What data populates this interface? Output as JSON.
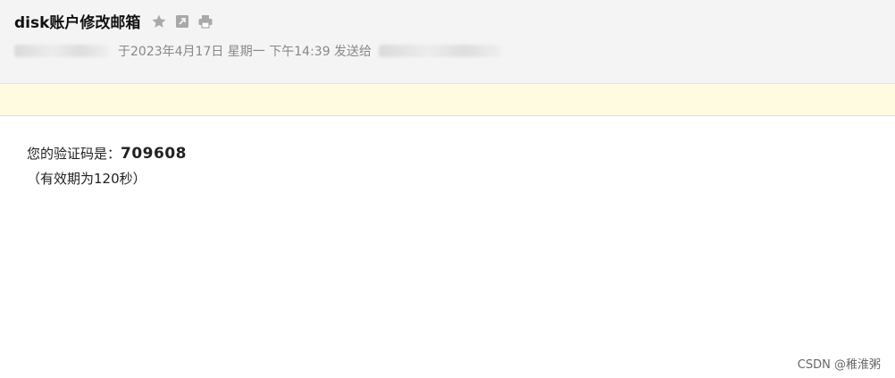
{
  "header": {
    "subject": "disk账户修改邮箱",
    "icons": [
      "star-icon",
      "open-external-icon",
      "print-icon"
    ],
    "meta_text": "于2023年4月17日 星期一 下午14:39 发送给"
  },
  "body": {
    "line1_prefix": "您的验证码是：",
    "code": "709608",
    "line2": "（有效期为120秒）"
  },
  "watermark": "CSDN @稚淮粥",
  "colors": {
    "header_bg": "#f4f4f4",
    "notice_bg": "#fffbe1",
    "icon": "#a9a9a9"
  }
}
